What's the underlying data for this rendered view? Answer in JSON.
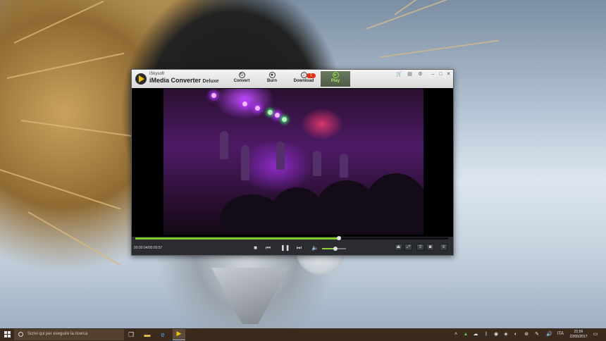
{
  "app": {
    "brand_prefix": "iSkysoft",
    "brand_name": "iMedia Converter",
    "brand_edition": "Deluxe"
  },
  "tabs": [
    {
      "label": "Convert",
      "icon": "convert-icon",
      "active": false
    },
    {
      "label": "Burn",
      "icon": "burn-icon",
      "active": false
    },
    {
      "label": "Download",
      "icon": "download-icon",
      "active": false
    },
    {
      "label": "Play",
      "icon": "play-icon",
      "active": true
    }
  ],
  "download_badge": "1",
  "player": {
    "timecode": "00:00:04/00:00:57",
    "progress": 0.65,
    "volume": 0.55
  },
  "taskbar": {
    "search_placeholder": "Scrivi qui per eseguire la ricerca",
    "language": "ITA",
    "time": "21:56",
    "date": "22/05/2017"
  },
  "colors": {
    "accent_green": "#7fcc2b",
    "badge_red": "#e1321a",
    "taskbar": "#3b2a1e"
  }
}
